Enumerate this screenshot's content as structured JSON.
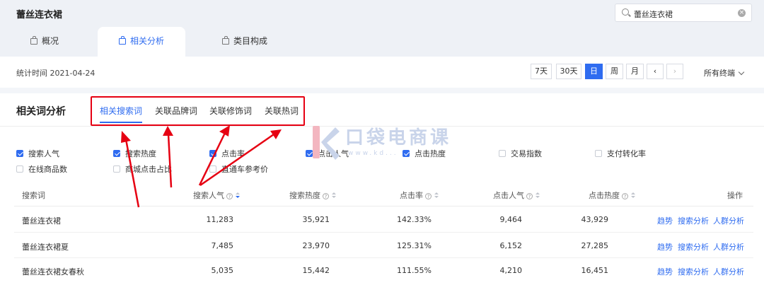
{
  "header": {
    "title": "蕾丝连衣裙",
    "search_value": "蕾丝连衣裙",
    "tabs": [
      {
        "label": "概况"
      },
      {
        "label": "相关分析"
      },
      {
        "label": "类目构成"
      }
    ]
  },
  "datebar": {
    "stat_time": "统计时间 2021-04-24",
    "ranges": [
      "7天",
      "30天",
      "日",
      "周",
      "月"
    ],
    "active_range": "日",
    "terminal": "所有终端"
  },
  "section": {
    "title": "相关词分析",
    "sub_tabs": [
      "相关搜索词",
      "关联品牌词",
      "关联修饰词",
      "关联热词"
    ]
  },
  "metrics": {
    "checked": [
      "搜索人气",
      "搜索热度",
      "点击率",
      "点击人气",
      "点击热度"
    ],
    "unchecked": [
      "交易指数",
      "支付转化率",
      "在线商品数",
      "商城点击占比",
      "直通车参考价"
    ]
  },
  "table": {
    "headers": [
      "搜索词",
      "搜索人气",
      "搜索热度",
      "点击率",
      "点击人气",
      "点击热度",
      "操作"
    ],
    "rows": [
      {
        "keyword": "蕾丝连衣裙",
        "search_pop": "11,283",
        "search_heat": "35,921",
        "ctr": "142.33%",
        "click_pop": "9,464",
        "click_heat": "43,929"
      },
      {
        "keyword": "蕾丝连衣裙夏",
        "search_pop": "7,485",
        "search_heat": "23,970",
        "ctr": "125.31%",
        "click_pop": "6,152",
        "click_heat": "27,285"
      },
      {
        "keyword": "蕾丝连衣裙女春秋",
        "search_pop": "5,035",
        "search_heat": "15,442",
        "ctr": "111.55%",
        "click_pop": "4,210",
        "click_heat": "16,451"
      }
    ],
    "actions": [
      "趋势",
      "搜索分析",
      "人群分析"
    ]
  },
  "watermark": {
    "brand": "口袋电商课",
    "url": "www.kd..."
  },
  "colors": {
    "accent": "#2f6cf0",
    "annotation_red": "#e60012"
  }
}
